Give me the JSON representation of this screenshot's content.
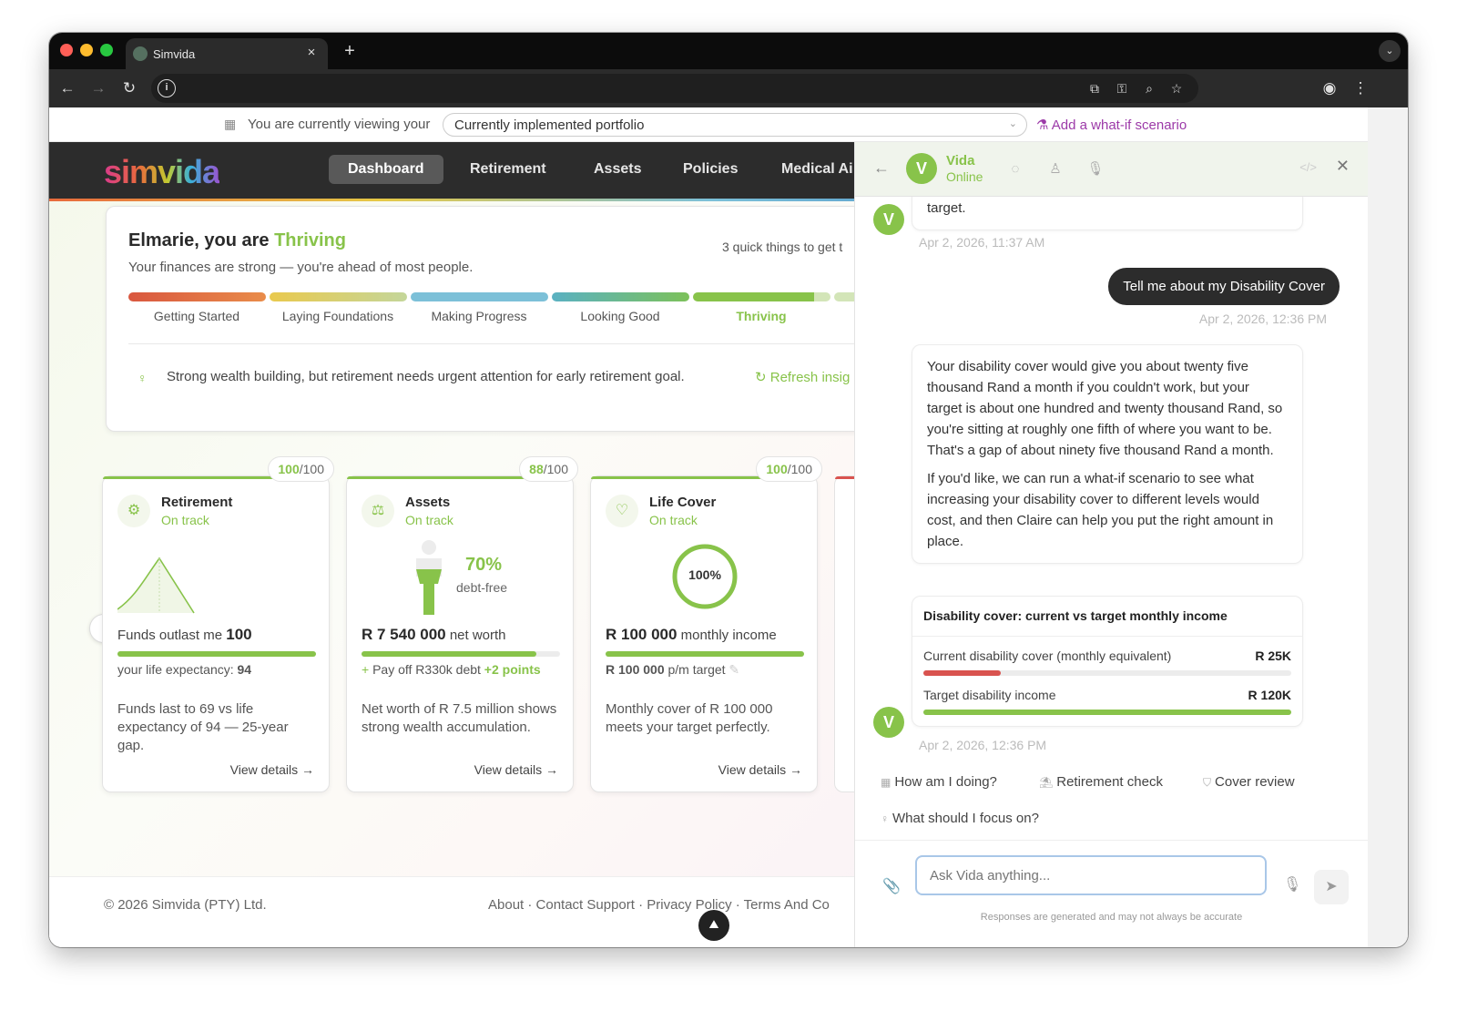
{
  "browser": {
    "tab_title": "Simvida",
    "tab_close": "×",
    "new_tab": "+",
    "tab_menu": "⌄"
  },
  "banner": {
    "text": "You are currently viewing your",
    "portfolio": "Currently implemented portfolio",
    "what_if": "Add a what-if scenario"
  },
  "nav": {
    "logo": "simvida",
    "items": [
      "Dashboard",
      "Retirement",
      "Assets",
      "Policies",
      "Medical Ai"
    ]
  },
  "hero": {
    "greeting": "Elmarie, you are ",
    "status": "Thriving",
    "subtitle": "Your finances are strong — you're ahead of most people.",
    "quick_things": "3 quick things to get t",
    "stages": [
      "Getting Started",
      "Laying Foundations",
      "Making Progress",
      "Looking Good",
      "Thriving"
    ],
    "insight": "Strong wealth building, but retirement needs urgent attention for early retirement goal.",
    "refresh": "Refresh insig"
  },
  "cards": [
    {
      "score": "100",
      "score_max": "/100",
      "title": "Retirement",
      "status": "On track",
      "metric_label": "Funds outlast me",
      "metric_value": "100",
      "progress": 1.0,
      "sub_label": "your life expectancy: ",
      "sub_value": "94",
      "description": "Funds last to 69 vs life expectancy of 94 — 25-year gap.",
      "link": "View details →"
    },
    {
      "score": "88",
      "score_max": "/100",
      "title": "Assets",
      "status": "On track",
      "chart_value": "70%",
      "chart_caption": "debt-free",
      "metric_value": "R 7 540 000",
      "metric_label": "net worth",
      "progress": 0.88,
      "sub_label": "Pay off R330k debt",
      "sub_points": "+2 points",
      "description": "Net worth of R 7.5 million shows strong wealth accumulation.",
      "link": "View details →"
    },
    {
      "score": "100",
      "score_max": "/100",
      "title": "Life Cover",
      "status": "On track",
      "ring_value": "100%",
      "metric_value": "R 100 000",
      "metric_label": "monthly income",
      "progress": 1.0,
      "sub_value": "R 100 000",
      "sub_label": "p/m target",
      "description": "Monthly cover of R 100 000 meets your target perfectly.",
      "link": "View details →"
    }
  ],
  "footer": {
    "copyright": "© 2026 Simvida (PTY) Ltd.",
    "links": "About · Contact Support · Privacy Policy · Terms And Co"
  },
  "chat": {
    "name": "Vida",
    "status": "Online",
    "messages": {
      "prev_tail": "target.",
      "prev_time": "Apr 2, 2026, 11:37 AM",
      "user_msg": "Tell me about my Disability Cover",
      "user_time": "Apr 2, 2026, 12:36 PM",
      "reply_p1": "Your disability cover would give you about twenty five thousand Rand a month if you couldn't work, but your target is about one hundred and twenty thousand Rand, so you're sitting at roughly one fifth of where you want to be. That's a gap of about ninety five thousand Rand a month.",
      "reply_p2": "If you'd like, we can run a what-if scenario to see what increasing your disability cover to different levels would cost, and then Claire can help you put the right amount in place.",
      "card_title": "Disability cover: current vs target monthly income",
      "row1_label": "Current disability cover (monthly equivalent)",
      "row1_value": "R 25K",
      "row1_fraction": 0.21,
      "row2_label": "Target disability income",
      "row2_value": "R 120K",
      "row2_fraction": 1.0,
      "reply_time": "Apr 2, 2026, 12:36 PM"
    },
    "suggestions": [
      "How am I doing?",
      "Retirement check",
      "Cover review",
      "What should I focus on?"
    ],
    "input_placeholder": "Ask Vida anything...",
    "disclaimer": "Responses are generated and may not always be accurate"
  },
  "colors": {
    "accent_green": "#88c34a",
    "accent_purple": "#9c3aa8",
    "stage_colors": [
      "#e86a3c",
      "#e6c845",
      "#7cc0d8",
      "#4aa8b8",
      "#88c34a"
    ],
    "cover_current": "#d9534f",
    "cover_target": "#88c34a"
  }
}
